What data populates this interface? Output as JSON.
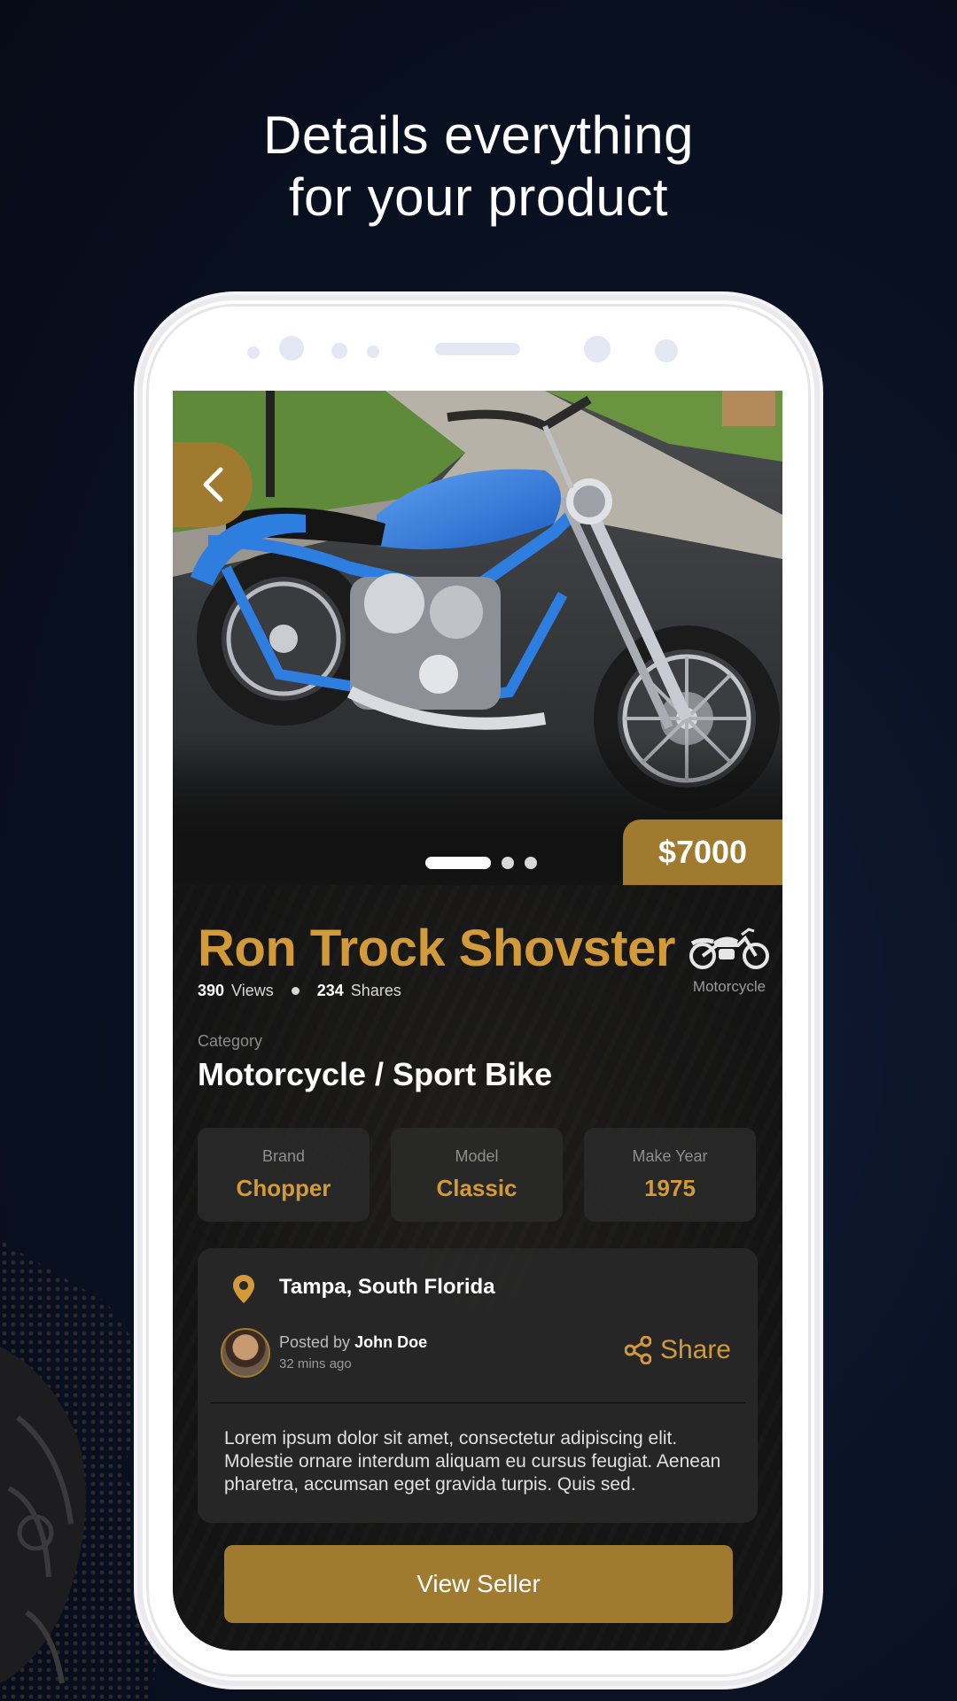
{
  "headline": {
    "line1": "Details everything",
    "line2": "for your product"
  },
  "product": {
    "price": "$7000",
    "title": "Ron Trock Shovster",
    "type_label": "Motorcycle",
    "views_count": "390",
    "views_label": "Views",
    "shares_count": "234",
    "shares_label": "Shares",
    "category_label": "Category",
    "category_value": "Motorcycle / Sport Bike",
    "specs": [
      {
        "label": "Brand",
        "value": "Chopper"
      },
      {
        "label": "Model",
        "value": "Classic"
      },
      {
        "label": "Make Year",
        "value": "1975"
      }
    ],
    "location": "Tampa, South Florida",
    "posted_prefix": "Posted by",
    "seller_name": "John Doe",
    "posted_time": "32 mins ago",
    "share_label": "Share",
    "description": "Lorem ipsum dolor sit amet, consectetur adipiscing elit. Molestie ornare interdum aliquam eu cursus feugiat. Aenean pharetra, accumsan eget gravida turpis. Quis sed.",
    "cta_label": "View Seller"
  },
  "carousel": {
    "total": 3,
    "active_index": 0
  },
  "colors": {
    "accent": "#a07a2e",
    "title_gold": "#d39a3a",
    "background": "#0a1224",
    "screen_bg": "#141414"
  },
  "icons": [
    "chevron-left-icon",
    "motorcycle-icon",
    "location-pin-icon",
    "share-icon"
  ]
}
